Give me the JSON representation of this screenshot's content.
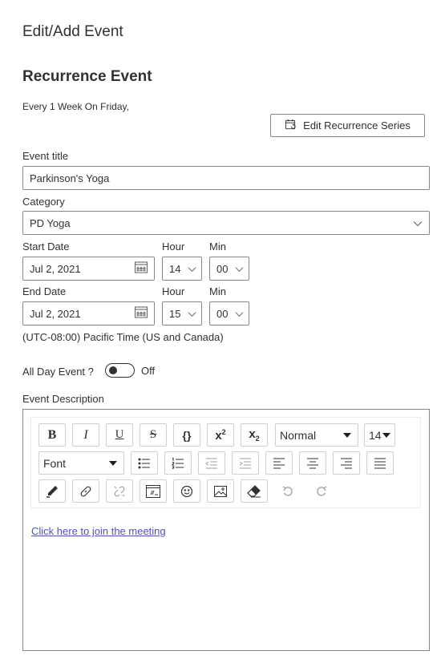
{
  "panel_title": "Edit/Add Event",
  "section_title": "Recurrence Event",
  "recurrence_text": "Every 1 Week On Friday,",
  "edit_recurrence_button": "Edit Recurrence Series",
  "event_title": {
    "label": "Event title",
    "value": "Parkinson's Yoga"
  },
  "category": {
    "label": "Category",
    "value": "PD Yoga"
  },
  "start": {
    "date_label": "Start Date",
    "date": "Jul 2, 2021",
    "hour_label": "Hour",
    "hour": "14",
    "min_label": "Min",
    "min": "00"
  },
  "end": {
    "date_label": "End Date",
    "date": "Jul 2, 2021",
    "hour_label": "Hour",
    "hour": "15",
    "min_label": "Min",
    "min": "00"
  },
  "timezone": "(UTC-08:00) Pacific Time (US and Canada)",
  "all_day": {
    "label": "All Day Event ?",
    "state": "Off",
    "on": false
  },
  "description_label": "Event Description",
  "editor": {
    "bold": "B",
    "italic": "I",
    "underline": "U",
    "strike": "S",
    "code": "{}",
    "superscript_base": "x",
    "superscript_mark": "2",
    "subscript_base": "x",
    "subscript_mark": "2",
    "paragraph_style": "Normal",
    "font_size": "14",
    "font": "Font",
    "content_link": "Click here to join the meeting"
  },
  "colors": {
    "text": "#323130",
    "border": "#8a8886",
    "link": "#4f52b2"
  }
}
